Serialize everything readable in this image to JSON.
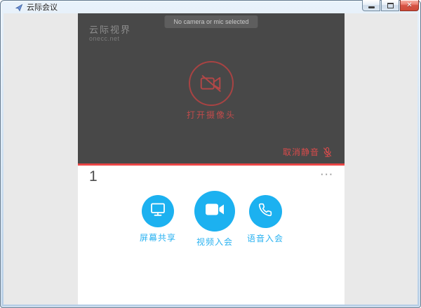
{
  "window": {
    "title": "云际会议",
    "close_glyph": "✕",
    "controls": [
      "minimize",
      "maximize",
      "close"
    ]
  },
  "video_area": {
    "toast": "No camera or mic selected",
    "watermark_line1": "云际视界",
    "watermark_line2": "onecc.net",
    "open_camera_label": "打开摄像头",
    "unmute_label": "取消静音"
  },
  "meeting_panel": {
    "participant_count": "1",
    "more_glyph": "···",
    "actions": [
      {
        "label": "屏幕共享",
        "icon": "screen-share-icon"
      },
      {
        "label": "视频入会",
        "icon": "video-camera-icon"
      },
      {
        "label": "语音入会",
        "icon": "phone-icon"
      }
    ]
  },
  "colors": {
    "accent_red": "#ea4545",
    "icon_red": "#c14b4b",
    "accent_blue": "#1cb1f0",
    "dark_bg": "#484848",
    "toast_bg": "#5e5e5e",
    "panel_gray": "#e9e9e9"
  }
}
